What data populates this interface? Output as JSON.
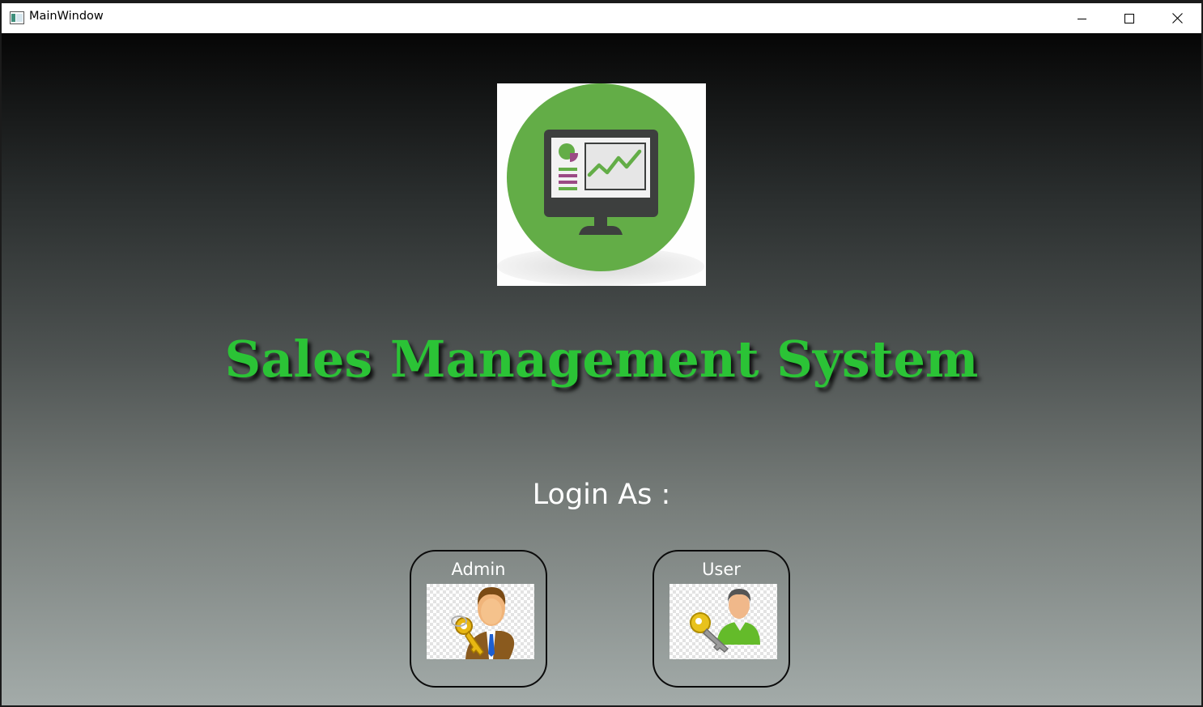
{
  "window": {
    "title": "MainWindow",
    "icon": "app-window-icon",
    "controls": [
      "minimize-icon",
      "maximize-icon",
      "close-icon"
    ]
  },
  "app": {
    "title": "Sales Management System",
    "logo": "sales-dashboard-monitor-logo",
    "colors": {
      "title_green": "#2bc336",
      "logo_green": "#63ad47",
      "logo_monitor": "#3d3f3e"
    }
  },
  "login": {
    "label": "Login As :",
    "buttons": [
      {
        "label": "Admin",
        "icon": "admin-key-user-icon"
      },
      {
        "label": "User",
        "icon": "user-key-icon"
      }
    ]
  }
}
